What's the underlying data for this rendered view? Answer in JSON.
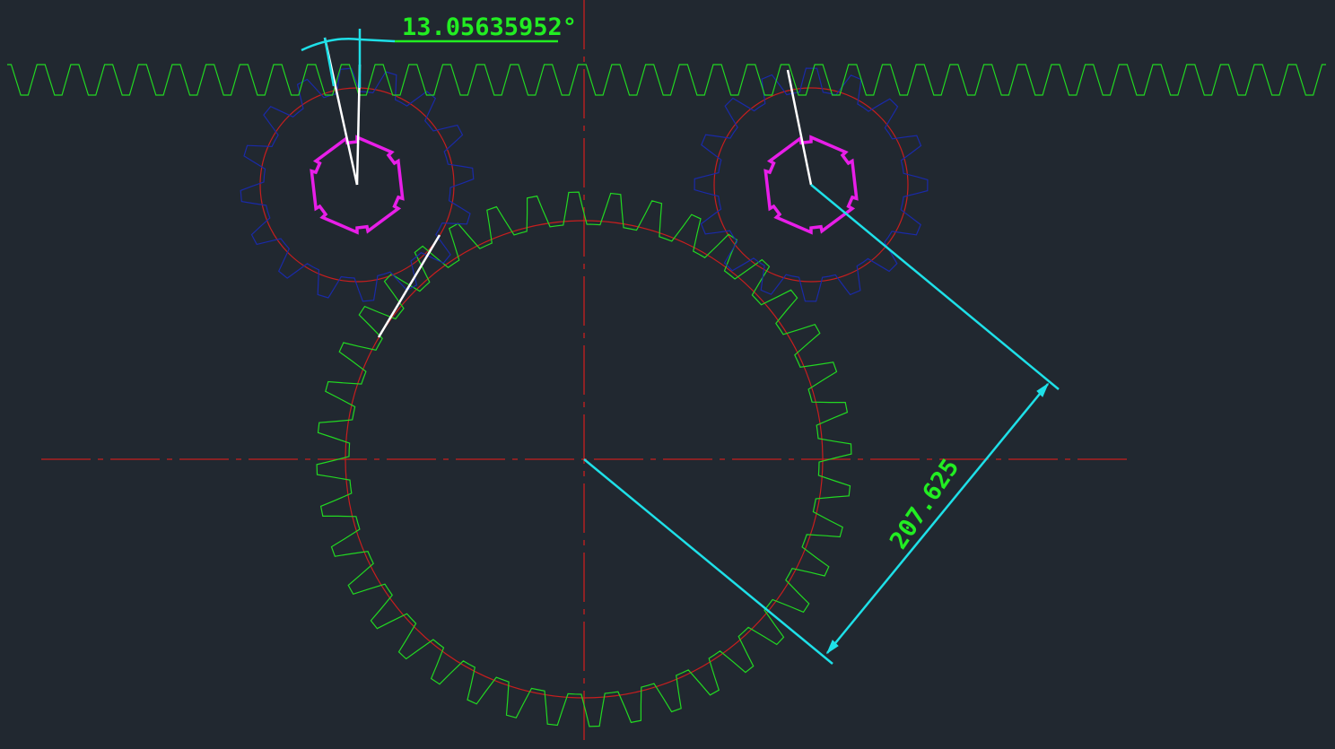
{
  "drawing": {
    "background": "#212830",
    "colors": {
      "large_gear": "#22d822",
      "rack": "#22d822",
      "small_gear": "#1a2aa8",
      "pitch_circle": "#c81e1e",
      "bore": "#e81ee8",
      "centerline": "#c81e1e",
      "dimension": "#1ee0e8",
      "dimension_text": "#22ee22",
      "construction": "#ffffff"
    },
    "large_gear": {
      "teeth": 40
    },
    "small_gears": [
      {
        "name": "left",
        "teeth": 16,
        "bore_keyways": 6
      },
      {
        "name": "right",
        "teeth": 16,
        "bore_keyways": 6
      }
    ],
    "rack": {
      "teeth": 39
    },
    "dimensions": {
      "angle": {
        "text": "13.05635952°"
      },
      "linear": {
        "text": "207.625"
      }
    }
  }
}
